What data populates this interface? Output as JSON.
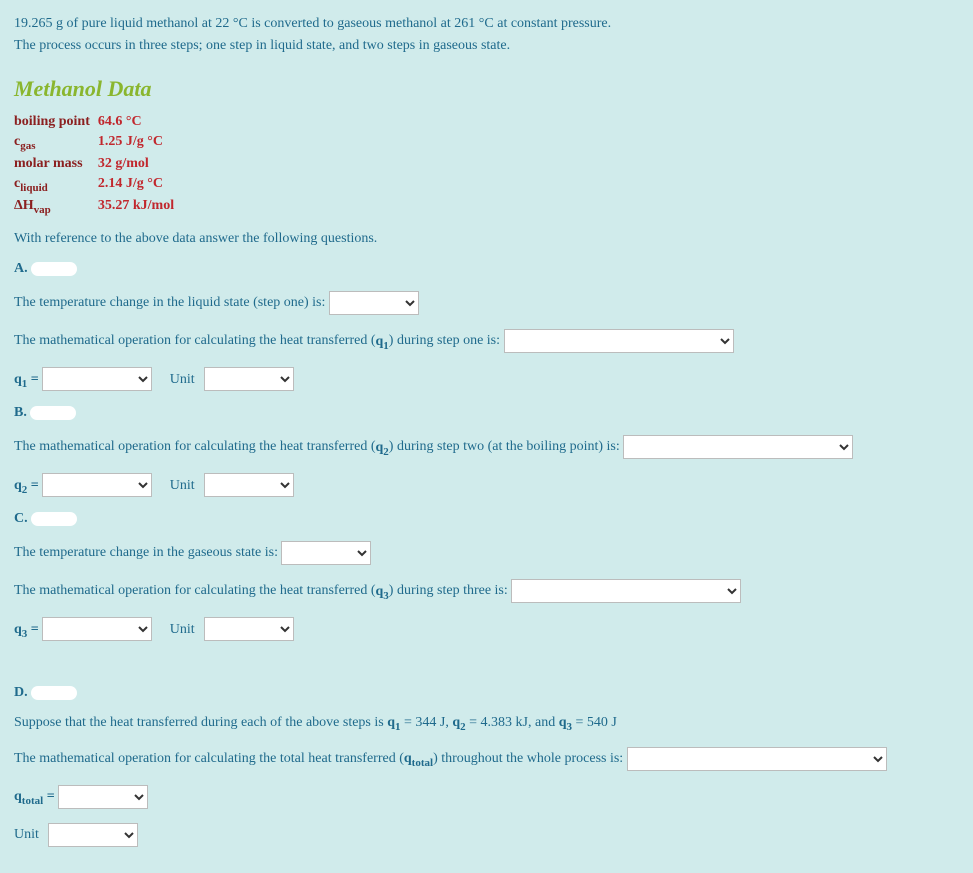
{
  "intro": {
    "line1": "19.265 g of pure liquid methanol at 22 °C  is converted to gaseous methanol at 261 °C at constant pressure.",
    "line2": "The process occurs in three steps; one step in liquid state, and two steps in gaseous state."
  },
  "heading": "Methanol Data",
  "data_table": {
    "r1_label": "boiling point",
    "r1_val": "64.6 °C",
    "r2_label_pre": "c",
    "r2_label_sub": "gas",
    "r2_val": "1.25 J/g °C",
    "r3_label": "molar mass",
    "r3_val": "32 g/mol",
    "r4_label_pre": "c",
    "r4_label_sub": "liquid",
    "r4_val": "2.14 J/g °C",
    "r5_label_pre": "ΔH",
    "r5_label_sub": "vap",
    "r5_val": "35.27 kJ/mol"
  },
  "instruction": "With reference to the above data answer the following questions.",
  "A": {
    "letter": "A.",
    "q1_text": "The temperature change in the liquid state (step one) is:",
    "q2_text_pre": "The mathematical operation for calculating the heat transferred (",
    "q2_sym_pre": "q",
    "q2_sym_sub": "1",
    "q2_text_post": ") during step one is:",
    "eq_sym_pre": "q",
    "eq_sym_sub": "1",
    "eq_eq": " =",
    "unit_label": "Unit"
  },
  "B": {
    "letter": "B.",
    "q_text_pre": "The mathematical operation for calculating the heat transferred (",
    "q_sym_pre": "q",
    "q_sym_sub": "2",
    "q_text_post": ") during step two (at the boiling point) is:",
    "eq_sym_pre": "q",
    "eq_sym_sub": "2",
    "eq_eq": " =",
    "unit_label": "Unit"
  },
  "C": {
    "letter": "C.",
    "q1_text": "The temperature change in the gaseous state is:",
    "q2_text_pre": "The mathematical operation for calculating the heat transferred (",
    "q2_sym_pre": "q",
    "q2_sym_sub": "3",
    "q2_text_post": ") during step three is:",
    "eq_sym_pre": "q",
    "eq_sym_sub": "3",
    "eq_eq": " =",
    "unit_label": "Unit"
  },
  "D": {
    "letter": "D.",
    "suppose_pre": "Suppose that the heat transferred during each of the above steps is ",
    "s1_pre": "q",
    "s1_sub": "1",
    "s1_val": " = 344 J, ",
    "s2_pre": "q",
    "s2_sub": "2",
    "s2_val": " = 4.383  kJ, and ",
    "s3_pre": "q",
    "s3_sub": "3",
    "s3_val": " = 540 J",
    "q_text_pre": "The mathematical operation for calculating the total heat transferred (",
    "q_sym_pre": "q",
    "q_sym_sub": "total",
    "q_text_post": ") throughout the whole process is:",
    "eq_sym_pre": "q",
    "eq_sym_sub": "total",
    "eq_eq": " =",
    "unit_label": "Unit"
  }
}
